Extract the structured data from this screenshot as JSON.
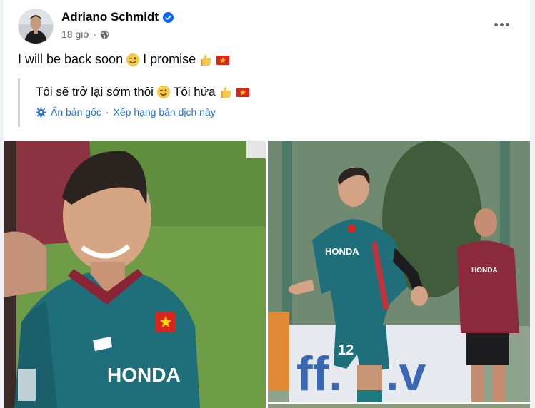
{
  "post": {
    "author": "Adriano Schmidt",
    "time": "18 giờ",
    "separator": "·",
    "text_part1": "I will be back soon",
    "text_part2": "I promise"
  },
  "translation": {
    "text_part1": "Tôi sẽ trở lại sớm thôi",
    "text_part2": "Tôi hứa",
    "see_original": "Ẩn bản gốc",
    "separator": "·",
    "rate_translation": "Xếp hạng bản dịch này"
  },
  "icons": {
    "verified": "verified-badge-icon",
    "privacy": "globe-icon",
    "more": "more-horizontal-icon",
    "settings": "gear-icon",
    "wink_emoji": "wink-emoji-icon",
    "thumbs_up_emoji": "thumbs-up-emoji-icon",
    "flag_emoji": "vietnam-flag-emoji-icon"
  },
  "colors": {
    "link": "#216fdb",
    "verified": "#0866ff",
    "secondary_text": "#65676b",
    "jersey": "#1f6f7a",
    "pitch": "#6d9a45"
  },
  "photos": {
    "photo1_sponsor": "HONDA",
    "photo2_sponsor": "HONDA",
    "photo2_number": "12",
    "photo2_banner": "ff.   g.v"
  }
}
